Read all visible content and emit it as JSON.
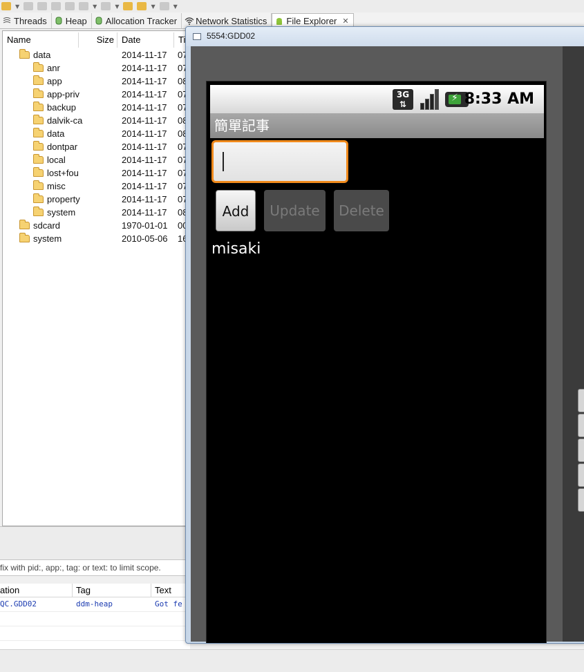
{
  "tabs": [
    {
      "label": "Threads"
    },
    {
      "label": "Heap"
    },
    {
      "label": "Allocation Tracker"
    },
    {
      "label": "Network Statistics"
    },
    {
      "label": "File Explorer",
      "active": true
    }
  ],
  "explorer": {
    "columns": {
      "name": "Name",
      "size": "Size",
      "date": "Date",
      "time": "Ti"
    },
    "rows": [
      {
        "name": "data",
        "date": "2014-11-17",
        "time": "07",
        "depth": 1
      },
      {
        "name": "anr",
        "date": "2014-11-17",
        "time": "07",
        "depth": 2
      },
      {
        "name": "app",
        "date": "2014-11-17",
        "time": "08",
        "depth": 2
      },
      {
        "name": "app-priv",
        "date": "2014-11-17",
        "time": "07",
        "depth": 2
      },
      {
        "name": "backup",
        "date": "2014-11-17",
        "time": "07",
        "depth": 2
      },
      {
        "name": "dalvik-ca",
        "date": "2014-11-17",
        "time": "08",
        "depth": 2
      },
      {
        "name": "data",
        "date": "2014-11-17",
        "time": "08",
        "depth": 2
      },
      {
        "name": "dontpar",
        "date": "2014-11-17",
        "time": "07",
        "depth": 2
      },
      {
        "name": "local",
        "date": "2014-11-17",
        "time": "07",
        "depth": 2
      },
      {
        "name": "lost+fou",
        "date": "2014-11-17",
        "time": "07",
        "depth": 2
      },
      {
        "name": "misc",
        "date": "2014-11-17",
        "time": "07",
        "depth": 2
      },
      {
        "name": "property",
        "date": "2014-11-17",
        "time": "07",
        "depth": 2
      },
      {
        "name": "system",
        "date": "2014-11-17",
        "time": "08",
        "depth": 2
      },
      {
        "name": "sdcard",
        "date": "1970-01-01",
        "time": "00",
        "depth": 1
      },
      {
        "name": "system",
        "date": "2010-05-06",
        "time": "16",
        "depth": 1
      }
    ]
  },
  "logcat": {
    "filter_hint": "fix with pid:, app:, tag: or text: to limit scope.",
    "columns": {
      "application": "ation",
      "tag": "Tag",
      "text": "Text"
    },
    "rows": [
      {
        "application": "QC.GDD02",
        "tag": "ddm-heap",
        "text": "Got fe"
      }
    ]
  },
  "emulator": {
    "window_title": "5554:GDD02",
    "status_bar": {
      "network": "3G",
      "time": "8:33 AM"
    },
    "app_title": "簡單記事",
    "input_value": "",
    "buttons": {
      "add": "Add",
      "update": "Update",
      "delete": "Delete"
    },
    "notes": [
      "misaki"
    ]
  },
  "colors": {
    "input_focus": "#f08a1c",
    "battery": "#3ea33a"
  }
}
